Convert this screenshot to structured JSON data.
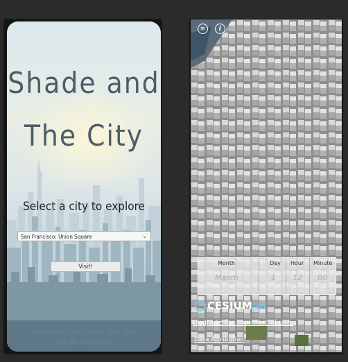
{
  "landing": {
    "title_line1": "Shade and",
    "title_line2": "The City",
    "subtitle": "Select a city to explore",
    "city_select_value": "San Francisco: Union Square",
    "visit_label": "Visit!",
    "credit_line1": "Created by Cyril, Jimmy, and Stew",
    "credit_line2": "For XR Bootcamp"
  },
  "viewer": {
    "menu_icon": "hamburger-icon",
    "info_icon": "info-icon",
    "info_glyph": "i",
    "time_panel": {
      "month_label": "Month",
      "day_label": "Day",
      "hour_label": "Hour",
      "minute_label": "Minute",
      "month_value": "March",
      "day_value": "1",
      "hour_value": "12",
      "minute_value": "00"
    },
    "logo_text": "CESIUM",
    "logo_suffix": "ion",
    "upgrade_link": "Upgrade for commercial use.",
    "data_attribution": "Data Attribution"
  },
  "colors": {
    "background": "#2b2b2b",
    "title_text": "#4b5d68",
    "cesium_accent": "#6ec8ef"
  }
}
